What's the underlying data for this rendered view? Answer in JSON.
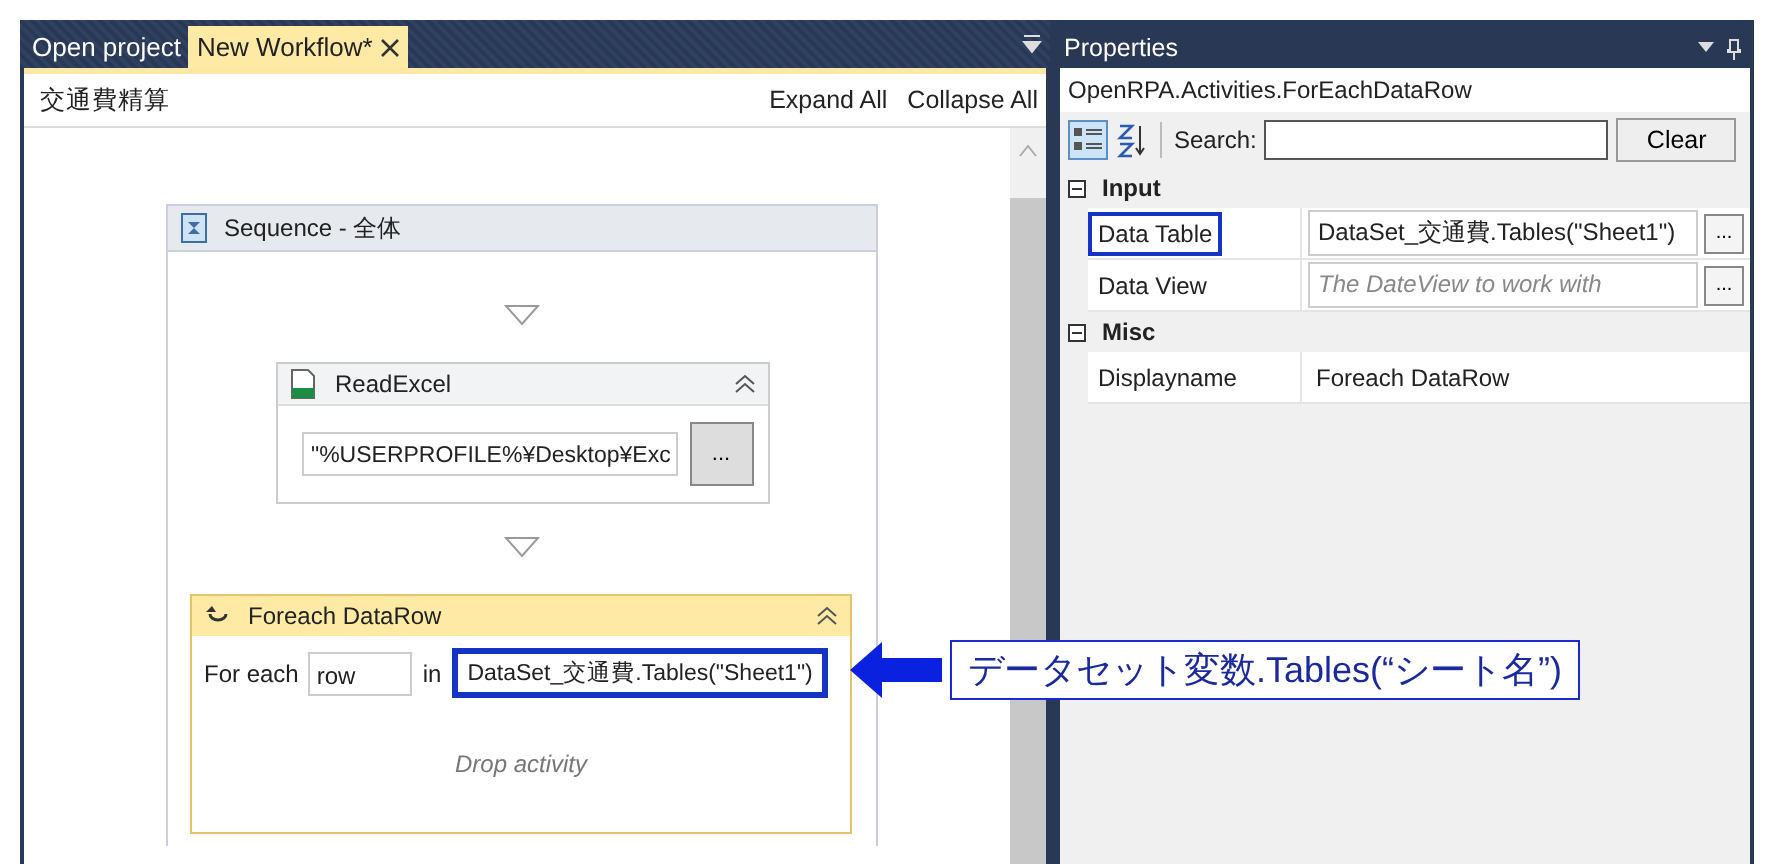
{
  "tabs": [
    {
      "label": "Open project",
      "selected": false
    },
    {
      "label": "New Workflow*",
      "selected": true
    }
  ],
  "workflow": {
    "title": "交通費精算",
    "actions": [
      "Expand All",
      "Collapse All"
    ],
    "sequence": {
      "title": "Sequence - 全体",
      "activities": [
        {
          "kind": "read_excel",
          "title": "ReadExcel",
          "path": "\"%USERPROFILE%¥Desktop¥Exc",
          "button": "..."
        },
        {
          "kind": "foreach",
          "title": "Foreach DataRow",
          "for_each_label": "For each",
          "variable": "row",
          "in_label": "in",
          "source": "DataSet_交通費.Tables(\"Sheet1\")",
          "highlighted": true,
          "drop_hint": "Drop activity"
        }
      ]
    }
  },
  "annotation": {
    "text": "データセット変数.Tables(“シート名”)"
  },
  "properties": {
    "title": "Properties",
    "type_name": "OpenRPA.Activities.ForEachDataRow",
    "search_label": "Search:",
    "clear_button": "Clear",
    "categories": [
      {
        "name": "Input",
        "expanded": true,
        "rows": [
          {
            "name": "Data Table",
            "value": "DataSet_交通費.Tables(\"Sheet1\")",
            "highlighted": true,
            "button": "..."
          },
          {
            "name": "Data View",
            "placeholder": "The DateView to work with",
            "highlighted": false,
            "button": "..."
          }
        ]
      },
      {
        "name": "Misc",
        "expanded": true,
        "rows": [
          {
            "name": "Displayname",
            "value": "Foreach DataRow",
            "highlighted": false
          }
        ]
      }
    ]
  }
}
